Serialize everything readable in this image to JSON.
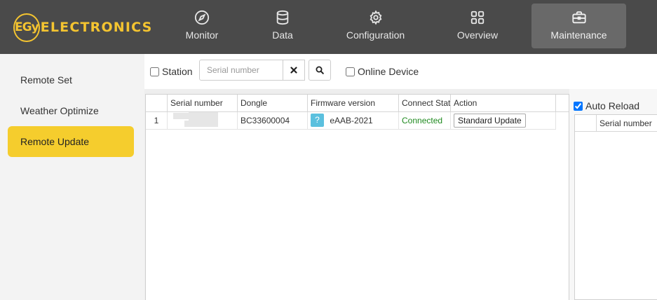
{
  "logo": {
    "badge": "EGy",
    "text": "ELECTRONICS"
  },
  "nav": [
    {
      "label": "Monitor",
      "icon": "compass-icon",
      "active": false
    },
    {
      "label": "Data",
      "icon": "database-icon",
      "active": false
    },
    {
      "label": "Configuration",
      "icon": "gear-icon",
      "active": false
    },
    {
      "label": "Overview",
      "icon": "grid-icon",
      "active": false
    },
    {
      "label": "Maintenance",
      "icon": "briefcase-icon",
      "active": true
    }
  ],
  "sidebar": {
    "items": [
      {
        "label": "Remote Set",
        "active": false
      },
      {
        "label": "Weather Optimize",
        "active": false
      },
      {
        "label": "Remote Update",
        "active": true
      }
    ]
  },
  "toolbar": {
    "station_label": "Station",
    "station_checked": false,
    "search_placeholder": "Serial number",
    "search_value": "",
    "online_label": "Online Device",
    "online_checked": false
  },
  "grid": {
    "columns": [
      "Serial number",
      "Dongle",
      "Firmware version",
      "Connect Stat",
      "Action"
    ],
    "rows": [
      {
        "index": "1",
        "serial": "",
        "dongle": "BC33600004",
        "firmware_badge": "?",
        "firmware": "eAAB-2021",
        "status": "Connected",
        "action": "Standard Update"
      }
    ]
  },
  "right_panel": {
    "auto_reload_label": "Auto Reload",
    "auto_reload_checked": true,
    "columns": [
      "Serial number"
    ]
  },
  "colors": {
    "topbar": "#4a4a4a",
    "accent": "#f5cd2d",
    "logo": "#f4c430",
    "connected": "#1f8a1f",
    "badge": "#5bc0de"
  }
}
